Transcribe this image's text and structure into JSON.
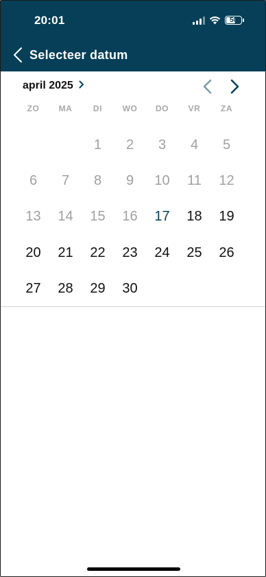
{
  "status_bar": {
    "time": "20:01",
    "battery_level": "50"
  },
  "header": {
    "title": "Selecteer datum",
    "background_color": "#063f57",
    "back_icon": "chevron-left-icon"
  },
  "calendar": {
    "month_label": "april 2025",
    "month_picker_icon": "chevron-right-icon",
    "prev_icon": "chevron-left-icon",
    "next_icon": "chevron-right-icon",
    "weekdays": [
      "ZO",
      "MA",
      "DI",
      "WO",
      "DO",
      "VR",
      "ZA"
    ],
    "days": [
      {
        "label": "",
        "state": "empty"
      },
      {
        "label": "",
        "state": "empty"
      },
      {
        "label": "1",
        "state": "past"
      },
      {
        "label": "2",
        "state": "past"
      },
      {
        "label": "3",
        "state": "past"
      },
      {
        "label": "4",
        "state": "past"
      },
      {
        "label": "5",
        "state": "past"
      },
      {
        "label": "6",
        "state": "past"
      },
      {
        "label": "7",
        "state": "past"
      },
      {
        "label": "8",
        "state": "past"
      },
      {
        "label": "9",
        "state": "past"
      },
      {
        "label": "10",
        "state": "past"
      },
      {
        "label": "11",
        "state": "past"
      },
      {
        "label": "12",
        "state": "past"
      },
      {
        "label": "13",
        "state": "past"
      },
      {
        "label": "14",
        "state": "past"
      },
      {
        "label": "15",
        "state": "past"
      },
      {
        "label": "16",
        "state": "past"
      },
      {
        "label": "17",
        "state": "today"
      },
      {
        "label": "18",
        "state": "available"
      },
      {
        "label": "19",
        "state": "available"
      },
      {
        "label": "20",
        "state": "available"
      },
      {
        "label": "21",
        "state": "available"
      },
      {
        "label": "22",
        "state": "available"
      },
      {
        "label": "23",
        "state": "available"
      },
      {
        "label": "24",
        "state": "available"
      },
      {
        "label": "25",
        "state": "available"
      },
      {
        "label": "26",
        "state": "available"
      },
      {
        "label": "27",
        "state": "available"
      },
      {
        "label": "28",
        "state": "available"
      },
      {
        "label": "29",
        "state": "available"
      },
      {
        "label": "30",
        "state": "available"
      }
    ],
    "colors": {
      "past": "#a0a0a0",
      "today": "#063f57",
      "available": "#111111",
      "prev_arrow": "#7d9aa8",
      "next_arrow": "#063f57"
    }
  }
}
